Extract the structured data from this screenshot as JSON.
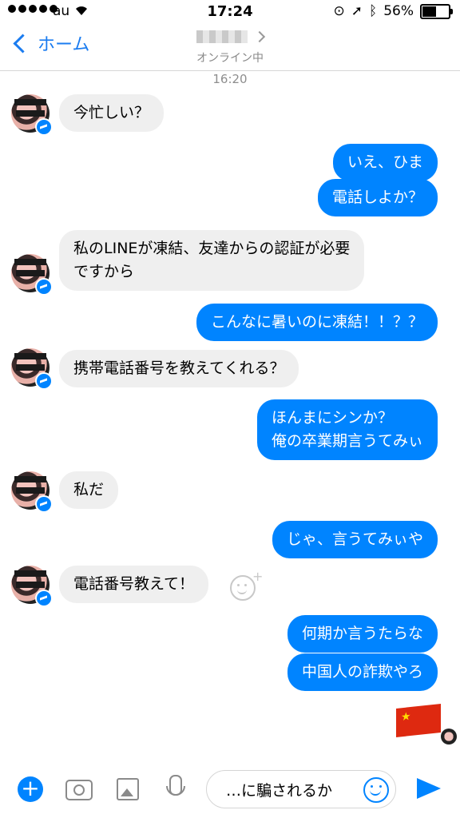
{
  "status_bar": {
    "carrier": "au",
    "time": "17:24",
    "battery": "56%",
    "battery_level": 0.56
  },
  "nav": {
    "back_label": "ホーム",
    "contact_status": "オンライン中"
  },
  "timestamp": "16:20",
  "messages": [
    {
      "side": "in",
      "text": "今忙しい？"
    },
    {
      "side": "out",
      "text": "いえ、ひま"
    },
    {
      "side": "out",
      "text": "電話しよか？"
    },
    {
      "side": "in",
      "text": "私のLINEが凍結、友達からの認証が必要\nですから"
    },
    {
      "side": "out",
      "text": "こんなに暑いのに凍結！！？？"
    },
    {
      "side": "in",
      "text": "携帯電話番号を教えてくれる？"
    },
    {
      "side": "out",
      "text": "ほんまにシンか？\n俺の卒業期言うてみぃ"
    },
    {
      "side": "in",
      "text": "私だ"
    },
    {
      "side": "out",
      "text": "じゃ、言うてみぃや"
    },
    {
      "side": "in",
      "text": "電話番号教えて！"
    },
    {
      "side": "out",
      "text": "何期か言うたらな"
    },
    {
      "side": "out",
      "text": "中国人の詐欺やろ"
    }
  ],
  "composer": {
    "input_value": "…に騙されるか"
  },
  "colors": {
    "accent": "#0084ff",
    "incoming_bubble": "#efefef",
    "back_link": "#1b7cf0"
  },
  "icons": [
    "wifi-icon",
    "location-icon",
    "bluetooth-icon",
    "battery-icon",
    "back-chevron-icon",
    "plus-icon",
    "camera-icon",
    "photo-icon",
    "microphone-icon",
    "emoji-icon",
    "send-icon",
    "china-flag-sticker"
  ]
}
